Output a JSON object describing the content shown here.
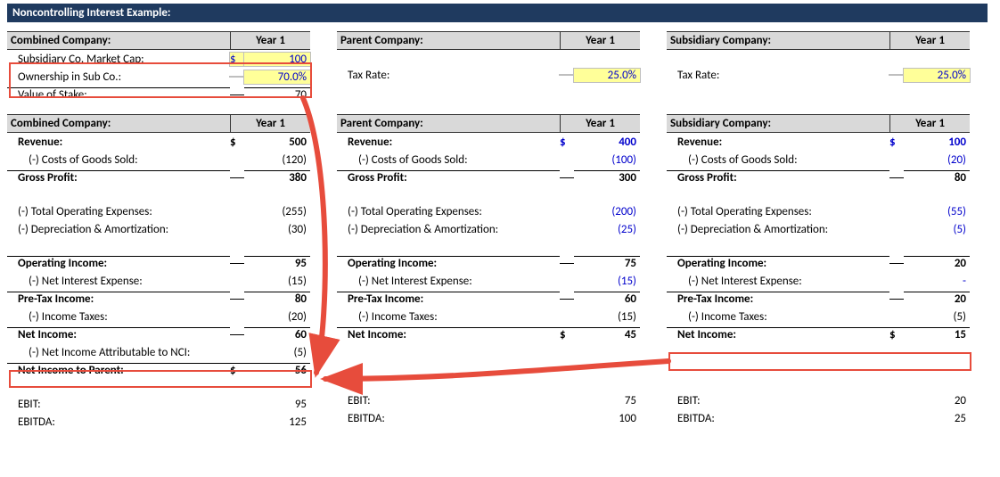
{
  "title": "Noncontrolling Interest Example:",
  "year_label": "Year 1",
  "top": {
    "combined": {
      "header": "Combined Company:",
      "rows": {
        "market_cap": {
          "label": "Subsidiary Co. Market Cap:",
          "currency": "$",
          "value": "100"
        },
        "ownership": {
          "label": "Ownership in Sub Co.:",
          "value": "70.0%"
        },
        "stake": {
          "label": "Value of Stake:",
          "value": "70"
        }
      }
    },
    "parent": {
      "header": "Parent Company:",
      "tax_rate": {
        "label": "Tax Rate:",
        "value": "25.0%"
      }
    },
    "subsidiary": {
      "header": "Subsidiary Company:",
      "tax_rate": {
        "label": "Tax Rate:",
        "value": "25.0%"
      }
    }
  },
  "is": {
    "combined": {
      "header": "Combined Company:",
      "revenue": {
        "label": "Revenue:",
        "currency": "$",
        "value": "500"
      },
      "cogs": {
        "label": "(-) Costs of Goods Sold:",
        "value": "(120)"
      },
      "gp": {
        "label": "Gross Profit:",
        "value": "380"
      },
      "opex": {
        "label": "(-) Total Operating Expenses:",
        "value": "(255)"
      },
      "da": {
        "label": "(-) Depreciation & Amortization:",
        "value": "(30)"
      },
      "opinc": {
        "label": "Operating Income:",
        "value": "95"
      },
      "nie": {
        "label": "(-) Net Interest Expense:",
        "value": "(15)"
      },
      "pti": {
        "label": "Pre-Tax Income:",
        "value": "80"
      },
      "tax": {
        "label": "(-) Income Taxes:",
        "value": "(20)"
      },
      "ni": {
        "label": "Net Income:",
        "value": "60"
      },
      "nci": {
        "label": "(-) Net Income Attributable to NCI:",
        "value": "(5)"
      },
      "nip": {
        "label": "Net Income to Parent:",
        "currency": "$",
        "value": "56"
      },
      "ebit": {
        "label": "EBIT:",
        "value": "95"
      },
      "ebitda": {
        "label": "EBITDA:",
        "value": "125"
      }
    },
    "parent": {
      "header": "Parent Company:",
      "revenue": {
        "label": "Revenue:",
        "currency": "$",
        "value": "400"
      },
      "cogs": {
        "label": "(-) Costs of Goods Sold:",
        "value": "(100)"
      },
      "gp": {
        "label": "Gross Profit:",
        "value": "300"
      },
      "opex": {
        "label": "(-) Total Operating Expenses:",
        "value": "(200)"
      },
      "da": {
        "label": "(-) Depreciation & Amortization:",
        "value": "(25)"
      },
      "opinc": {
        "label": "Operating Income:",
        "value": "75"
      },
      "nie": {
        "label": "(-) Net Interest Expense:",
        "value": "(15)"
      },
      "pti": {
        "label": "Pre-Tax Income:",
        "value": "60"
      },
      "tax": {
        "label": "(-) Income Taxes:",
        "value": "(15)"
      },
      "ni": {
        "label": "Net Income:",
        "currency": "$",
        "value": "45"
      },
      "ebit": {
        "label": "EBIT:",
        "value": "75"
      },
      "ebitda": {
        "label": "EBITDA:",
        "value": "100"
      }
    },
    "subsidiary": {
      "header": "Subsidiary Company:",
      "revenue": {
        "label": "Revenue:",
        "currency": "$",
        "value": "100"
      },
      "cogs": {
        "label": "(-) Costs of Goods Sold:",
        "value": "(20)"
      },
      "gp": {
        "label": "Gross Profit:",
        "value": "80"
      },
      "opex": {
        "label": "(-) Total Operating Expenses:",
        "value": "(55)"
      },
      "da": {
        "label": "(-) Depreciation & Amortization:",
        "value": "(5)"
      },
      "opinc": {
        "label": "Operating Income:",
        "value": "20"
      },
      "nie": {
        "label": "(-) Net Interest Expense:",
        "value": "-"
      },
      "pti": {
        "label": "Pre-Tax Income:",
        "value": "20"
      },
      "tax": {
        "label": "(-) Income Taxes:",
        "value": "(5)"
      },
      "ni": {
        "label": "Net Income:",
        "currency": "$",
        "value": "15"
      },
      "ebit": {
        "label": "EBIT:",
        "value": "20"
      },
      "ebitda": {
        "label": "EBITDA:",
        "value": "25"
      }
    }
  },
  "chart_data": {
    "type": "table",
    "title": "Noncontrolling Interest Example",
    "combined": {
      "revenue": 500,
      "cogs": -120,
      "gross_profit": 380,
      "opex": -255,
      "da": -30,
      "operating_income": 95,
      "net_interest_expense": -15,
      "pretax_income": 80,
      "income_taxes": -20,
      "net_income": 60,
      "nci": -5,
      "net_income_to_parent": 56,
      "ebit": 95,
      "ebitda": 125,
      "subsidiary_market_cap": 100,
      "ownership_pct": 0.7,
      "value_of_stake": 70
    },
    "parent": {
      "tax_rate": 0.25,
      "revenue": 400,
      "cogs": -100,
      "gross_profit": 300,
      "opex": -200,
      "da": -25,
      "operating_income": 75,
      "net_interest_expense": -15,
      "pretax_income": 60,
      "income_taxes": -15,
      "net_income": 45,
      "ebit": 75,
      "ebitda": 100
    },
    "subsidiary": {
      "tax_rate": 0.25,
      "revenue": 100,
      "cogs": -20,
      "gross_profit": 80,
      "opex": -55,
      "da": -5,
      "operating_income": 20,
      "net_interest_expense": 0,
      "pretax_income": 20,
      "income_taxes": -5,
      "net_income": 15,
      "ebit": 20,
      "ebitda": 25
    }
  }
}
